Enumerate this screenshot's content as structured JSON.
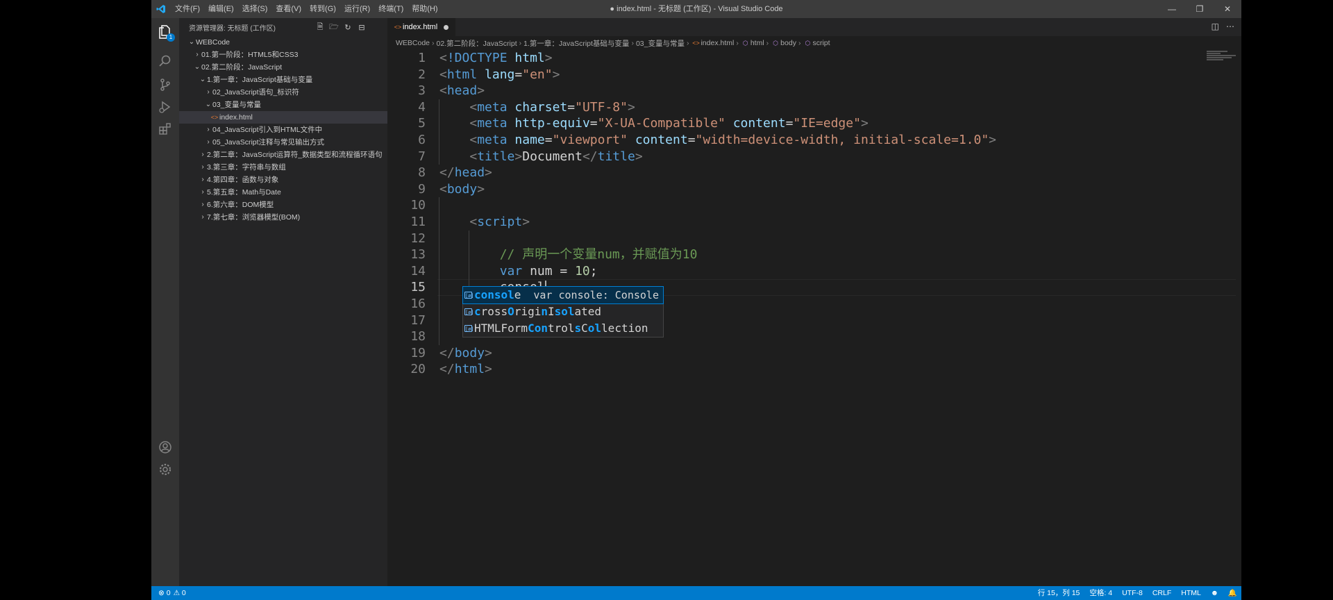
{
  "window": {
    "title": "● index.html - 无标题 (工作区) - Visual Studio Code",
    "menu": [
      "文件(F)",
      "编辑(E)",
      "选择(S)",
      "查看(V)",
      "转到(G)",
      "运行(R)",
      "终端(T)",
      "帮助(H)"
    ]
  },
  "activity_bar": {
    "explorer_badge": "1"
  },
  "sidebar": {
    "header": "资源管理器: 无标题 (工作区)",
    "tree": [
      {
        "label": "WEBCode",
        "depth": 0,
        "chev": "⌄",
        "type": "folder"
      },
      {
        "label": "01.第一阶段：HTML5和CSS3",
        "depth": 1,
        "chev": "›",
        "type": "folder"
      },
      {
        "label": "02.第二阶段：JavaScript",
        "depth": 1,
        "chev": "⌄",
        "type": "folder"
      },
      {
        "label": "1.第一章：JavaScript基础与变量",
        "depth": 2,
        "chev": "⌄",
        "type": "folder"
      },
      {
        "label": "02_JavaScript语句_标识符",
        "depth": 3,
        "chev": "›",
        "type": "folder"
      },
      {
        "label": "03_变量与常量",
        "depth": 3,
        "chev": "⌄",
        "type": "folder"
      },
      {
        "label": "index.html",
        "depth": 4,
        "chev": "",
        "type": "file",
        "selected": true
      },
      {
        "label": "04_JavaScript引入到HTML文件中",
        "depth": 3,
        "chev": "›",
        "type": "folder"
      },
      {
        "label": "05_JavaScript注释与常见输出方式",
        "depth": 3,
        "chev": "›",
        "type": "folder"
      },
      {
        "label": "2.第二章：JavaScript运算符_数据类型和流程循环语句",
        "depth": 2,
        "chev": "›",
        "type": "folder"
      },
      {
        "label": "3.第三章：字符串与数组",
        "depth": 2,
        "chev": "›",
        "type": "folder"
      },
      {
        "label": "4.第四章：函数与对象",
        "depth": 2,
        "chev": "›",
        "type": "folder"
      },
      {
        "label": "5.第五章：Math与Date",
        "depth": 2,
        "chev": "›",
        "type": "folder"
      },
      {
        "label": "6.第六章：DOM模型",
        "depth": 2,
        "chev": "›",
        "type": "folder"
      },
      {
        "label": "7.第七章：浏览器模型(BOM)",
        "depth": 2,
        "chev": "›",
        "type": "folder"
      }
    ]
  },
  "tabs": [
    {
      "label": "index.html",
      "modified": true
    }
  ],
  "breadcrumb": [
    "WEBCode",
    "02.第二阶段：JavaScript",
    "1.第一章：JavaScript基础与变量",
    "03_变量与常量",
    "index.html",
    "html",
    "body",
    "script"
  ],
  "editor": {
    "active_line": 15,
    "lines": [
      {
        "n": "1",
        "indent": 0,
        "tokens": [
          [
            "p",
            "<"
          ],
          [
            "tag",
            "!DOCTYPE"
          ],
          [
            "txt",
            " "
          ],
          [
            "attr",
            "html"
          ],
          [
            "p",
            ">"
          ]
        ]
      },
      {
        "n": "2",
        "indent": 0,
        "tokens": [
          [
            "p",
            "<"
          ],
          [
            "tag",
            "html"
          ],
          [
            "txt",
            " "
          ],
          [
            "attr",
            "lang"
          ],
          [
            "txt",
            "="
          ],
          [
            "str",
            "\"en\""
          ],
          [
            "p",
            ">"
          ]
        ]
      },
      {
        "n": "3",
        "indent": 0,
        "tokens": [
          [
            "p",
            "<"
          ],
          [
            "tag",
            "head"
          ],
          [
            "p",
            ">"
          ]
        ]
      },
      {
        "n": "4",
        "indent": 1,
        "tokens": [
          [
            "p",
            "<"
          ],
          [
            "tag",
            "meta"
          ],
          [
            "txt",
            " "
          ],
          [
            "attr",
            "charset"
          ],
          [
            "txt",
            "="
          ],
          [
            "str",
            "\"UTF-8\""
          ],
          [
            "p",
            ">"
          ]
        ]
      },
      {
        "n": "5",
        "indent": 1,
        "tokens": [
          [
            "p",
            "<"
          ],
          [
            "tag",
            "meta"
          ],
          [
            "txt",
            " "
          ],
          [
            "attr",
            "http-equiv"
          ],
          [
            "txt",
            "="
          ],
          [
            "str",
            "\"X-UA-Compatible\""
          ],
          [
            "txt",
            " "
          ],
          [
            "attr",
            "content"
          ],
          [
            "txt",
            "="
          ],
          [
            "str",
            "\"IE=edge\""
          ],
          [
            "p",
            ">"
          ]
        ]
      },
      {
        "n": "6",
        "indent": 1,
        "tokens": [
          [
            "p",
            "<"
          ],
          [
            "tag",
            "meta"
          ],
          [
            "txt",
            " "
          ],
          [
            "attr",
            "name"
          ],
          [
            "txt",
            "="
          ],
          [
            "str",
            "\"viewport\""
          ],
          [
            "txt",
            " "
          ],
          [
            "attr",
            "content"
          ],
          [
            "txt",
            "="
          ],
          [
            "str",
            "\"width=device-width, initial-scale=1.0\""
          ],
          [
            "p",
            ">"
          ]
        ]
      },
      {
        "n": "7",
        "indent": 1,
        "tokens": [
          [
            "p",
            "<"
          ],
          [
            "tag",
            "title"
          ],
          [
            "p",
            ">"
          ],
          [
            "txt",
            "Document"
          ],
          [
            "p",
            "</"
          ],
          [
            "tag",
            "title"
          ],
          [
            "p",
            ">"
          ]
        ]
      },
      {
        "n": "8",
        "indent": 0,
        "tokens": [
          [
            "p",
            "</"
          ],
          [
            "tag",
            "head"
          ],
          [
            "p",
            ">"
          ]
        ]
      },
      {
        "n": "9",
        "indent": 0,
        "tokens": [
          [
            "p",
            "<"
          ],
          [
            "tag",
            "body"
          ],
          [
            "p",
            ">"
          ]
        ]
      },
      {
        "n": "10",
        "indent": 0,
        "tokens": []
      },
      {
        "n": "11",
        "indent": 1,
        "tokens": [
          [
            "p",
            "<"
          ],
          [
            "tag",
            "script"
          ],
          [
            "p",
            ">"
          ]
        ]
      },
      {
        "n": "12",
        "indent": 0,
        "tokens": []
      },
      {
        "n": "13",
        "indent": 2,
        "tokens": [
          [
            "com",
            "// 声明一个变量num，并赋值为10"
          ]
        ]
      },
      {
        "n": "14",
        "indent": 2,
        "tokens": [
          [
            "kw",
            "var"
          ],
          [
            "txt",
            " num = "
          ],
          [
            "num",
            "10"
          ],
          [
            "txt",
            ";"
          ]
        ]
      },
      {
        "n": "15",
        "indent": 2,
        "tokens": [
          [
            "txt",
            "consol"
          ]
        ]
      },
      {
        "n": "16",
        "indent": 0,
        "tokens": []
      },
      {
        "n": "17",
        "indent": 1,
        "tokens": [
          [
            "p",
            "</"
          ],
          [
            "tag",
            "script"
          ],
          [
            "p",
            ">"
          ]
        ]
      },
      {
        "n": "18",
        "indent": 0,
        "tokens": []
      },
      {
        "n": "19",
        "indent": 0,
        "tokens": [
          [
            "p",
            "</"
          ],
          [
            "tag",
            "body"
          ],
          [
            "p",
            ">"
          ]
        ]
      },
      {
        "n": "20",
        "indent": 0,
        "tokens": [
          [
            "p",
            "</"
          ],
          [
            "tag",
            "html"
          ],
          [
            "p",
            ">"
          ]
        ]
      }
    ]
  },
  "suggest": [
    {
      "parts": [
        [
          "hl",
          "consol"
        ],
        [
          "n",
          "e"
        ]
      ],
      "detail": "var console: Console",
      "selected": true
    },
    {
      "parts": [
        [
          "hl",
          "c"
        ],
        [
          "n",
          "ross"
        ],
        [
          "hl",
          "O"
        ],
        [
          "n",
          "rigi"
        ],
        [
          "hl",
          "n"
        ],
        [
          "n",
          "I"
        ],
        [
          "hl",
          "sol"
        ],
        [
          "n",
          "ated"
        ]
      ],
      "detail": "",
      "selected": false
    },
    {
      "parts": [
        [
          "n",
          "HTMLForm"
        ],
        [
          "hl",
          "Con"
        ],
        [
          "n",
          "trol"
        ],
        [
          "hl",
          "s"
        ],
        [
          "n",
          "C"
        ],
        [
          "hl",
          "ol"
        ],
        [
          "n",
          "lection"
        ]
      ],
      "detail": "",
      "selected": false
    }
  ],
  "statusbar": {
    "errors": "⊗ 0",
    "warnings": "⚠ 0",
    "position": "行 15，列 15",
    "spaces": "空格: 4",
    "encoding": "UTF-8",
    "eol": "CRLF",
    "language": "HTML"
  }
}
